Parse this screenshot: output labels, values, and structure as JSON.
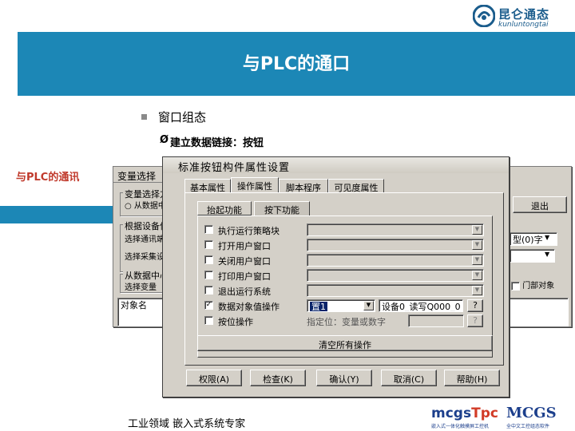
{
  "logo": {
    "name_cn": "昆仑通态",
    "name_en": "kunluntongtai"
  },
  "slide": {
    "title": "与PLC的通口",
    "bullet": "窗口组态",
    "sub_arrow": "Ø",
    "sub_bullet": "建立数据链接：按钮",
    "side_label": "与PLC的通讯"
  },
  "footer": {
    "text": "工业领域  嵌入式系统专家",
    "logo1_main": "mcgs",
    "logo1_accent": "Tpc",
    "logo1_sub": "嵌入式一体化触摸屏工控机",
    "logo2_main": "MCGS",
    "logo2_sub": "全中文工控组态软件"
  },
  "back_window": {
    "title": "变量选择",
    "group1": "变量选择方式",
    "radio1": "从数据中心选",
    "group2": "根据设备信息连接",
    "label_channel": "选择通讯端口",
    "label_device": "选择采集设备",
    "group3": "从数据中心选择",
    "label_var": "选择变量",
    "col_header": "对象名",
    "exit_label": "退出",
    "dropdown_value": "型(0)字",
    "chk_label": "门部对象"
  },
  "dialog": {
    "title": "标准按钮构件属性设置",
    "tabs": [
      "基本属性",
      "操作属性",
      "脚本程序",
      "可见度属性"
    ],
    "subtabs": [
      "抬起功能",
      "按下功能"
    ],
    "rows": [
      {
        "label": "执行运行策略块",
        "checked": false,
        "value": ""
      },
      {
        "label": "打开用户窗口",
        "checked": false,
        "value": ""
      },
      {
        "label": "关闭用户窗口",
        "checked": false,
        "value": ""
      },
      {
        "label": "打印用户窗口",
        "checked": false,
        "value": ""
      },
      {
        "label": "退出运行系统",
        "checked": false,
        "value": ""
      },
      {
        "label": "数据对象值操作",
        "checked": true,
        "value": "置1"
      },
      {
        "label": "按位操作",
        "checked": false,
        "value": ""
      }
    ],
    "data_object": "设备0_读写Q000_0",
    "q_mark": "?",
    "bit_label": "指定位：变量或数字",
    "clear_all": "清空所有操作",
    "buttons": [
      "权限(A)",
      "检查(K)",
      "确认(Y)",
      "取消(C)",
      "帮助(H)"
    ],
    "check_mark": "✓",
    "dd_arrow": "▼"
  }
}
